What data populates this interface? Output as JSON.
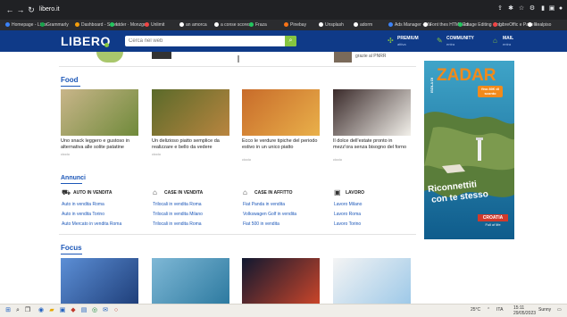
{
  "browser": {
    "url": "libero.it",
    "bookmarks": [
      "Homepage - Lidor",
      "Grammarly",
      "Dashboard - Score",
      "Ltder · Monzgo",
      "Unlimit",
      "an amorca",
      "a conse scores",
      "Fraza",
      "Pinebay",
      "Unsplash",
      "adorm",
      "Ads Manager · Ma",
      "Font thes HTML Edi",
      "Image Editing · Ing",
      "LibreOffic e Page s",
      "Realpiso"
    ],
    "bookmark_colors": [
      "#3b82f6",
      "#16a34a",
      "#f59e0b",
      "#22c55e",
      "#ef4444",
      "#ffffff",
      "#ffffff",
      "#22c55e",
      "#f97316",
      "#ffffff",
      "#ffffff",
      "#3b82f6",
      "#ffffff",
      "#22c55e",
      "#ef4444",
      "#ffffff"
    ]
  },
  "header": {
    "logo": "LIBERO",
    "search_placeholder": "Cerca nel web",
    "links": [
      {
        "title": "PREMIUM",
        "sub": "attiva",
        "icon": "premium-icon"
      },
      {
        "title": "COMMUNITY",
        "sub": "entra",
        "icon": "community-icon"
      },
      {
        "title": "MAIL",
        "sub": "entra",
        "icon": "mail-icon"
      }
    ]
  },
  "prev_section": {
    "snippet": "grazie al PNRR"
  },
  "food": {
    "title": "Food",
    "cards": [
      {
        "text": "Uno snack leggero e gustoso in alternativa alle solite patatine",
        "source": "ciccio",
        "colors": [
          "#c9b58a",
          "#6f8a3a"
        ]
      },
      {
        "text": "Un delizioso piatto semplice da realizzare e bello da vedere",
        "source": "ciccio",
        "colors": [
          "#5a6a2a",
          "#b9853f"
        ]
      },
      {
        "text": "Ecco le verdure tipiche del periodo estivo in un unico piatto",
        "source": "ciccio",
        "colors": [
          "#c86b2a",
          "#e9b04a"
        ]
      },
      {
        "text": "Il dolce dell'estate pronto in mezz'ora senza bisogno del forno",
        "source": "ciccio",
        "colors": [
          "#3a2a2a",
          "#f2f0ea"
        ]
      }
    ]
  },
  "annunci": {
    "title": "Annunci",
    "categories": [
      {
        "title": "AUTO IN VENDITA",
        "icon": "car-icon",
        "links": [
          "Auto in vendita Roma",
          "Auto in vendita Torino",
          "Auto Mercato in vendita Roma"
        ]
      },
      {
        "title": "CASE IN VENDITA",
        "icon": "house-sale-icon",
        "links": [
          "Trilocali in vendita Roma",
          "Trilocali in vendita Milano",
          "Trilocali in vendita Roma"
        ]
      },
      {
        "title": "CASE IN AFFITTO",
        "icon": "house-rent-icon",
        "links": [
          "Fiat Panda in vendita",
          "Volkswagen Golf in vendita",
          "Fiat 500 in vendita"
        ]
      },
      {
        "title": "LAVORO",
        "icon": "briefcase-icon",
        "links": [
          "Lavoro Milano",
          "Lavoro Roma",
          "Lavoro Torino"
        ]
      }
    ]
  },
  "focus": {
    "title": "Focus",
    "images": [
      {
        "colors": [
          "#5c8fd6",
          "#1f3f7a"
        ]
      },
      {
        "colors": [
          "#7fb8d6",
          "#2d7aa0"
        ]
      },
      {
        "colors": [
          "#101830",
          "#c9452a"
        ]
      },
      {
        "colors": [
          "#f4f4f4",
          "#9ec9e8"
        ]
      }
    ]
  },
  "ad": {
    "kicker": "ISOLA DI",
    "title": "ZADAR",
    "badge": "fino 80€ di sconto",
    "slogan_line1": "Riconnettiti",
    "slogan_line2": "con te stesso",
    "brand": "CROATIA",
    "brand_sub": "Full of life"
  },
  "taskbar": {
    "time": "15:11",
    "date": "29/05/2023",
    "lang": "ITA",
    "temp": "25°C",
    "weather": "Sunny"
  }
}
